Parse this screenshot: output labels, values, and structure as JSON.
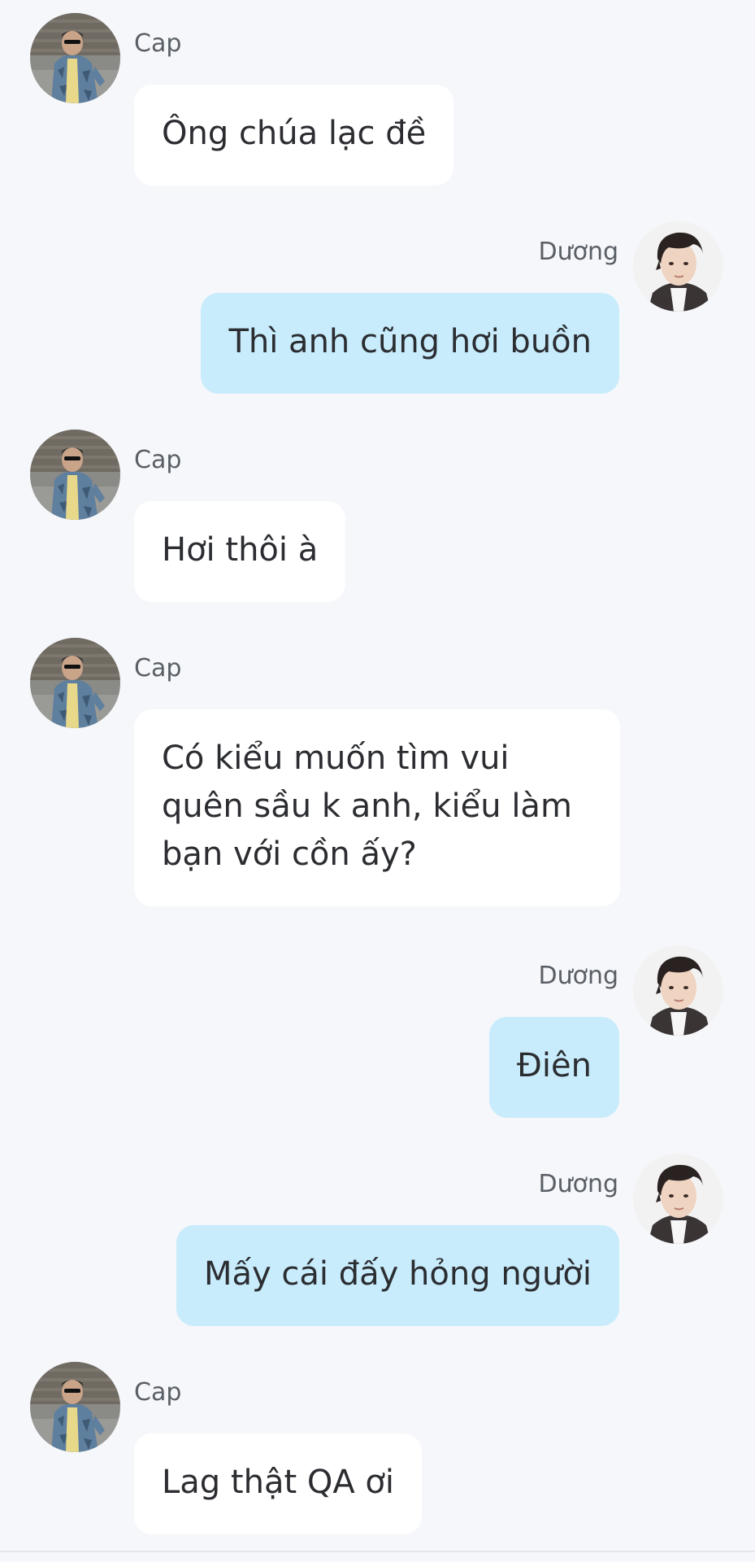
{
  "conversation": {
    "messages": [
      {
        "sender": "Cap",
        "side": "left",
        "text": "Ông chúa lạc đề"
      },
      {
        "sender": "Dương",
        "side": "right",
        "text": "Thì anh cũng hơi buồn"
      },
      {
        "sender": "Cap",
        "side": "left",
        "text": "Hơi thôi à"
      },
      {
        "sender": "Cap",
        "side": "left",
        "text": "Có kiểu muốn tìm vui quên sầu k anh, kiểu làm bạn với cồn ấy?"
      },
      {
        "sender": "Dương",
        "side": "right",
        "text": "Điên"
      },
      {
        "sender": "Dương",
        "side": "right",
        "text": "Mấy cái đấy hỏng người"
      },
      {
        "sender": "Cap",
        "side": "left",
        "text": "Lag thật QA ơi"
      }
    ]
  },
  "colors": {
    "background": "#f5f7fa",
    "incoming_bubble": "#ffffff",
    "outgoing_bubble": "#c8ecfc",
    "text": "#2b2d31",
    "sender_name": "#5a5f66"
  }
}
